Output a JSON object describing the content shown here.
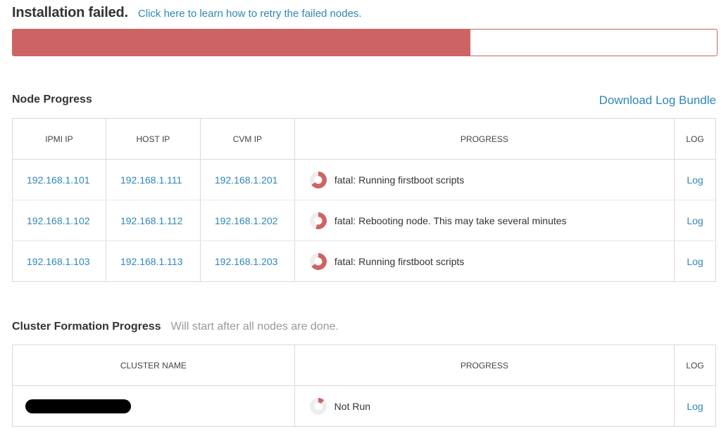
{
  "header": {
    "title": "Installation failed.",
    "retry_link": "Click here to learn how to retry the failed nodes."
  },
  "overall_progress": 0.65,
  "node_progress": {
    "title": "Node Progress",
    "download_link": "Download Log Bundle",
    "columns": [
      "IPMI IP",
      "HOST IP",
      "CVM IP",
      "PROGRESS",
      "LOG"
    ],
    "rows": [
      {
        "ipmi": "192.168.1.101",
        "host": "192.168.1.111",
        "cvm": "192.168.1.201",
        "progress": 0.65,
        "status": "fatal: Running firstboot scripts",
        "log": "Log"
      },
      {
        "ipmi": "192.168.1.102",
        "host": "192.168.1.112",
        "cvm": "192.168.1.202",
        "progress": 0.55,
        "status": "fatal: Rebooting node. This may take several minutes",
        "log": "Log"
      },
      {
        "ipmi": "192.168.1.103",
        "host": "192.168.1.113",
        "cvm": "192.168.1.203",
        "progress": 0.65,
        "status": "fatal: Running firstboot scripts",
        "log": "Log"
      }
    ]
  },
  "cluster_progress": {
    "title": "Cluster Formation Progress",
    "note": "Will start after all nodes are done.",
    "columns": [
      "CLUSTER NAME",
      "PROGRESS",
      "LOG"
    ],
    "rows": [
      {
        "progress": 0.12,
        "status": "Not Run",
        "log": "Log"
      }
    ]
  },
  "colors": {
    "accent": "#2e87b8",
    "fail": "#cd6464",
    "pie_bg": "#eeeeee"
  }
}
